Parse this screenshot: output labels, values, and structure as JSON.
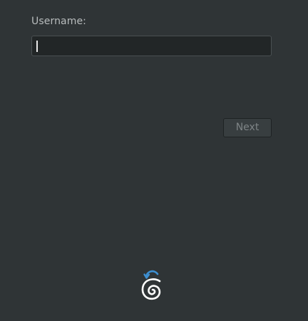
{
  "login": {
    "username_label": "Username:",
    "username_value": "",
    "next_label": "Next"
  },
  "icons": {
    "logo": "spiral-logo-icon"
  },
  "colors": {
    "background": "#2f3436",
    "input_background": "#222627",
    "logo_white": "#ffffff",
    "logo_accent": "#3d8fd1"
  }
}
